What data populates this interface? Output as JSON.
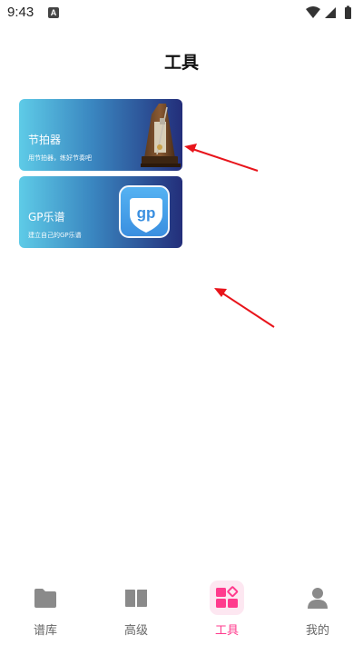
{
  "status_bar": {
    "time": "9:43",
    "notification_letter": "A",
    "icons": [
      "wifi-icon",
      "signal-icon",
      "battery-icon"
    ]
  },
  "page": {
    "title": "工具"
  },
  "tools": [
    {
      "title": "节拍器",
      "subtitle": "用节拍器，练好节奏吧",
      "icon": "metronome-icon"
    },
    {
      "title": "GP乐谱",
      "subtitle": "建立自己的GP乐谱",
      "icon": "gp-logo-icon",
      "logo_text": "gp"
    }
  ],
  "bottom_nav": {
    "items": [
      {
        "label": "谱库",
        "icon": "folder-icon",
        "active": false
      },
      {
        "label": "高级",
        "icon": "book-icon",
        "active": false
      },
      {
        "label": "工具",
        "icon": "tools-grid-icon",
        "active": true
      },
      {
        "label": "我的",
        "icon": "person-icon",
        "active": false
      }
    ]
  },
  "colors": {
    "accent": "#ff3b8d",
    "card_gradient_start": "#5ecbe7",
    "card_gradient_end": "#232e7a",
    "annotation": "#e8141b"
  }
}
